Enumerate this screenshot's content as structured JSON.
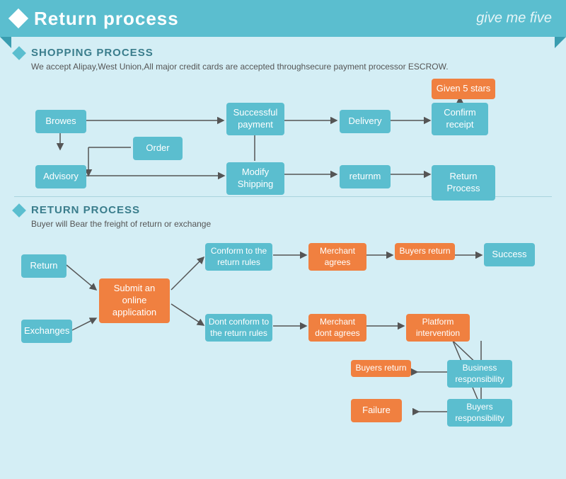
{
  "header": {
    "title": "Return process",
    "logo": "give me five"
  },
  "shopping_section": {
    "title": "SHOPPING PROCESS",
    "desc": "We accept Alipay,West Union,All major credit cards are accepted throughsecure payment processor ESCROW.",
    "boxes": {
      "browes": "Browes",
      "order": "Order",
      "advisory": "Advisory",
      "modify_shipping": "Modify Shipping",
      "successful_payment": "Successful payment",
      "delivery": "Delivery",
      "confirm_receipt": "Confirm receipt",
      "given_5_stars": "Given 5 stars",
      "returnm": "returnm",
      "return_process": "Return Process"
    }
  },
  "return_section": {
    "title": "RETURN PROCESS",
    "desc": "Buyer will Bear the freight of return or exchange",
    "boxes": {
      "return": "Return",
      "exchanges": "Exchanges",
      "submit": "Submit an online application",
      "conform": "Conform to the return rules",
      "dont_conform": "Dont conform to the return rules",
      "merchant_agrees": "Merchant agrees",
      "merchant_dont": "Merchant dont agrees",
      "buyers_return1": "Buyers return",
      "platform": "Platform intervention",
      "success": "Success",
      "buyers_return2": "Buyers return",
      "biz_responsibility": "Business responsibility",
      "failure": "Failure",
      "buyers_responsibility": "Buyers responsibility"
    }
  }
}
